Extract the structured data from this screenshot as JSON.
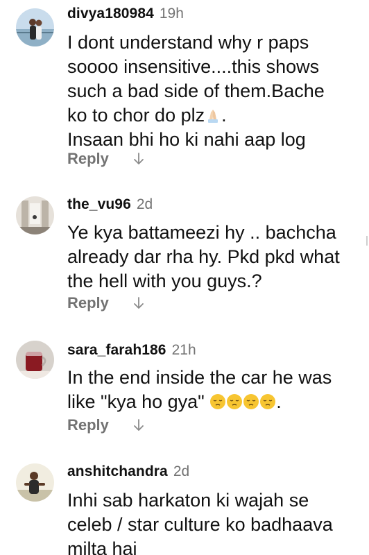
{
  "comments": [
    {
      "username": "divya180984",
      "time": "19h",
      "text_lines": [
        "I dont understand why r paps",
        "soooo insensitive....this shows",
        "such a bad side of them.Bache",
        "ko to chor do plz",
        "Insaan bhi ho ki nahi aap log"
      ],
      "emoji_after_line4": "folded-hands",
      "line4_suffix": ".",
      "reply_label": "Reply"
    },
    {
      "username": "the_vu96",
      "time": "2d",
      "text_lines": [
        "Ye kya battameezi hy .. bachcha",
        "already dar rha hy. Pkd pkd what",
        "the hell with you guys.?"
      ],
      "reply_label": "Reply"
    },
    {
      "username": "sara_farah186",
      "time": "21h",
      "text_lines": [
        "In the end inside the car he was",
        "like \"kya ho gya\""
      ],
      "emoji_after_line2": "pensive-face x4",
      "line2_suffix": ".",
      "reply_label": "Reply"
    },
    {
      "username": "anshitchandra",
      "time": "2d",
      "text_lines": [
        "Inhi sab harkaton ki wajah se",
        "celeb / star culture ko badhaava",
        "milta hai"
      ]
    }
  ],
  "icons": {
    "down_arrow": "arrow-down-icon",
    "folded_hands": "folded-hands-emoji",
    "pensive": "pensive-face-emoji"
  },
  "colors": {
    "text": "#111111",
    "secondary": "#737373"
  }
}
